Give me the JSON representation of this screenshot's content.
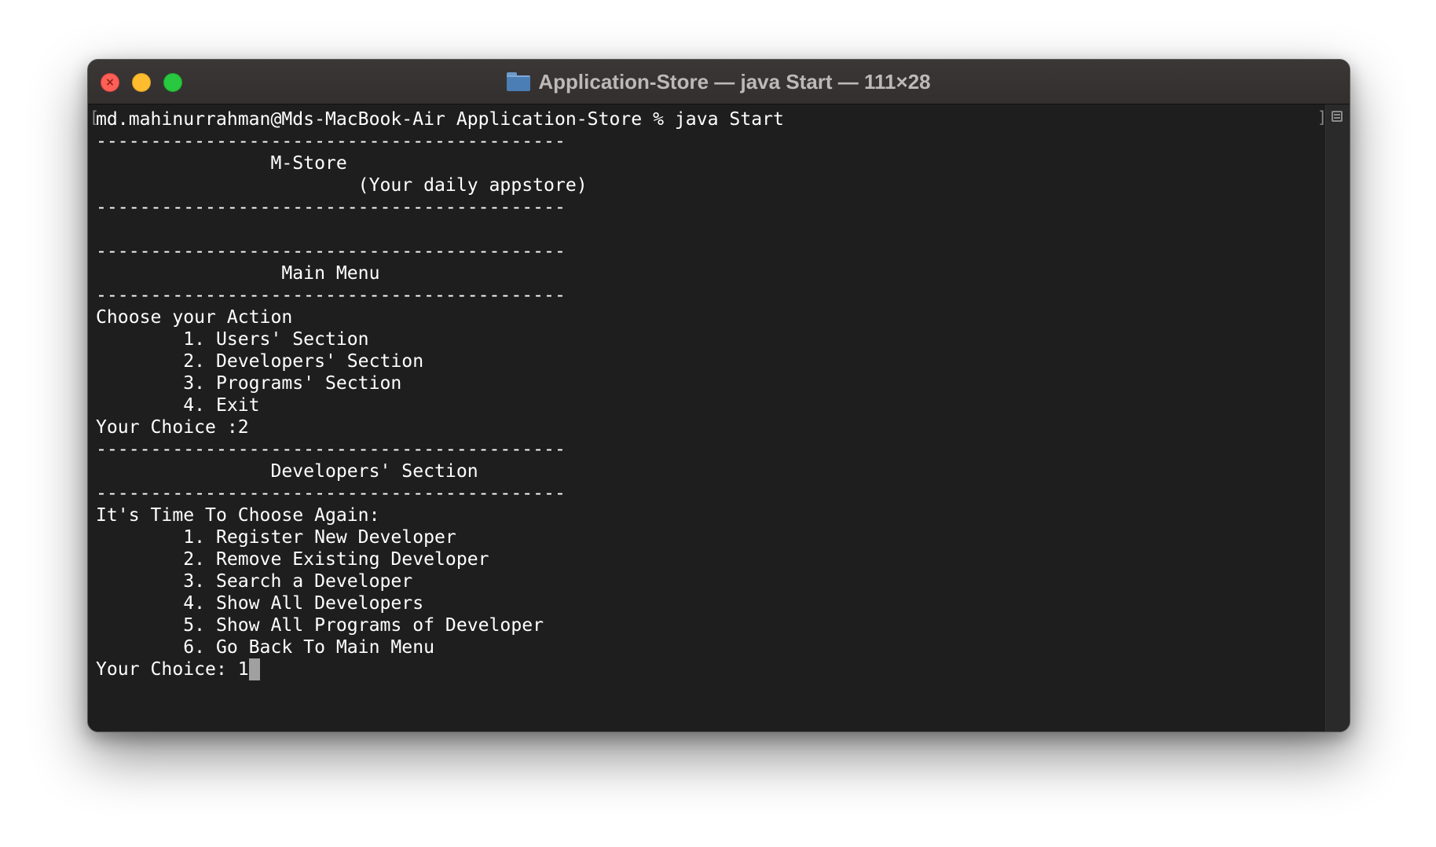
{
  "window": {
    "title": "Application-Store — java Start — 111×28",
    "folder_icon": "folder-icon",
    "buttons": {
      "close": "close-button",
      "minimize": "minimize-button",
      "zoom": "zoom-button"
    },
    "close_glyph": "×"
  },
  "terminal": {
    "prompt_line": "md.mahinurrahman@Mds-MacBook-Air Application-Store % java Start",
    "lines": [
      "-------------------------------------------",
      "                M-Store",
      "                        (Your daily appstore)",
      "-------------------------------------------",
      "",
      "-------------------------------------------",
      "                 Main Menu",
      "-------------------------------------------",
      "Choose your Action",
      "        1. Users' Section",
      "        2. Developers' Section",
      "        3. Programs' Section",
      "        4. Exit",
      "Your Choice :2",
      "-------------------------------------------",
      "                Developers' Section",
      "-------------------------------------------",
      "It's Time To Choose Again:",
      "        1. Register New Developer",
      "        2. Remove Existing Developer",
      "        3. Search a Developer",
      "        4. Show All Developers",
      "        5. Show All Programs of Developer",
      "        6. Go Back To Main Menu"
    ],
    "input_prompt": "Your Choice: ",
    "input_value": "1"
  },
  "colors": {
    "terminal_bg": "#1e1e1e",
    "titlebar_bg": "#383434",
    "text": "#ffffff",
    "title_text": "#bdb9b7",
    "close": "#fe5f57",
    "minimize": "#febc2e",
    "zoom": "#28c840"
  }
}
